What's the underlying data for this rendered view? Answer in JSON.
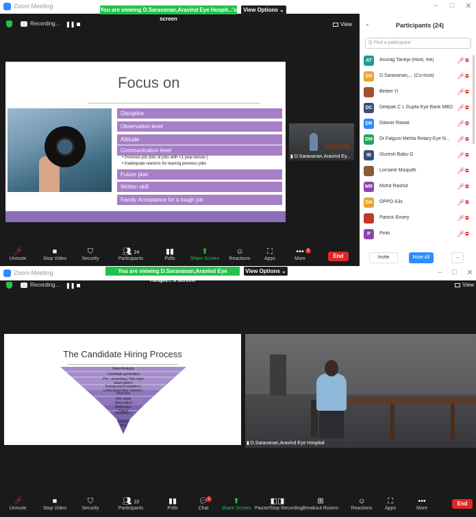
{
  "window1": {
    "title": "Zoom Meeting",
    "viewing_banner": "You are viewing D.Saravanan,Aravind Eye Hospit...'s screen",
    "view_options": "View Options ⌄",
    "recording_label": "Recording...",
    "view_label": "View",
    "slide": {
      "title": "Focus on",
      "bars": [
        "Discipline",
        "Observation level",
        "Attitude",
        "Communication level",
        "Future plan",
        "Written skill",
        "Family Acceptance for a tough job"
      ],
      "bullets": [
        "• Previous job (lots of jobs with <1 year tenure )",
        "• Inadequate reasons for leaving previous jobs"
      ]
    },
    "camera_label": "D.Saravanan,Aravind Ey...",
    "toolbar": {
      "unmute": "Unmute",
      "stop_video": "Stop Video",
      "security": "Security",
      "participants": "Participants",
      "participants_count": "24",
      "polls": "Polls",
      "share_screen": "Share Screen",
      "reactions": "Reactions",
      "apps": "Apps",
      "more": "More",
      "more_badge": "5",
      "end": "End"
    },
    "participants_panel": {
      "title": "Participants (24)",
      "search_placeholder": "Q Find a participant",
      "invite": "Invite",
      "mute_all": "Mute All",
      "more": "...",
      "people": [
        {
          "initials": "AT",
          "name": "Anurag Taneja (Host, me)",
          "color": "#1f9d8c"
        },
        {
          "initials": "DS",
          "name": "D.Saravanan,... (Co-host)",
          "color": "#e8a530"
        },
        {
          "initials": "",
          "name": "Beibei Yi",
          "color": "#a0522d"
        },
        {
          "initials": "DC",
          "name": "Deepak C L Gupta Eye Bank MBD",
          "color": "#3a4d7a"
        },
        {
          "initials": "DR",
          "name": "Dilavar Rawat",
          "color": "#2d8cff"
        },
        {
          "initials": "DM",
          "name": "Dr.Falguni Mehta Rotary Eye N...",
          "color": "#23a55a"
        },
        {
          "initials": "IB",
          "name": "iSuresh Babu G",
          "color": "#3a4d7a"
        },
        {
          "initials": "",
          "name": "Lorraine Misquith",
          "color": "#8a5a3c"
        },
        {
          "initials": "MR",
          "name": "Mohd Rashid",
          "color": "#8e44ad"
        },
        {
          "initials": "OA",
          "name": "OPPO A3s",
          "color": "#e8a530"
        },
        {
          "initials": "",
          "name": "Patrick Emery",
          "color": "#c0392b"
        },
        {
          "initials": "P",
          "name": "Pinki",
          "color": "#8e44ad"
        }
      ]
    }
  },
  "window2": {
    "title": "Zoom Meeting",
    "viewing_banner": "You are viewing D.Saravanan,Aravind Eye Hospit...'s screen",
    "view_options": "View Options ⌄",
    "recording_label": "Recording...",
    "view_label": "View",
    "slide": {
      "title": "The Candidate Hiring Process",
      "funnel": [
        "Need Analysis",
        "Candidate generation",
        "Pre - screening ( Two days observation)",
        "Testing and Evaluation ( Understand their interest )",
        "Interview",
        "One week observation",
        "Reference Check",
        "Placemen t",
        "Onboar ding"
      ]
    },
    "camera_label": "D.Saravanan,Aravind Eye Hospital",
    "toolbar": {
      "unmute": "Unmute",
      "stop_video": "Stop Video",
      "security": "Security",
      "participants": "Participants",
      "participants_count": "22",
      "polls": "Polls",
      "chat": "Chat",
      "chat_badge": "1",
      "share_screen": "Share Screen",
      "pause_recording": "Pause/Stop Recording",
      "breakout_rooms": "Breakout Rooms",
      "reactions": "Reactions",
      "apps": "Apps",
      "more": "More",
      "end": "End"
    }
  },
  "colors": {
    "green": "#23c24b",
    "purple_bar": "#a77fc7",
    "end_red": "#e02828",
    "zoom_blue": "#2d8cff"
  }
}
